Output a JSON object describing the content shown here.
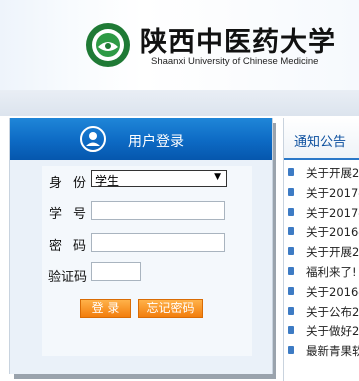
{
  "header": {
    "name_cn": "陕西中医药大学",
    "name_en": "Shaanxi University of Chinese Medicine",
    "logo_icon": "university-emblem-icon"
  },
  "login": {
    "title": "用户登录",
    "user_icon": "user-avatar-icon",
    "identity_label": "身份",
    "identity_value": "学生",
    "student_id_label": "学号",
    "password_label": "密码",
    "captcha_label": "验证码",
    "login_button": "登 录",
    "forgot_button": "忘记密码"
  },
  "notices": {
    "title": "通知公告",
    "items": [
      "关于开展2",
      "关于2017-",
      "关于2017-",
      "关于2016-",
      "关于开展2",
      "福利来了!",
      "关于2016-",
      "关于公布2",
      "关于做好2",
      "最新青果软"
    ]
  },
  "colors": {
    "login_header": "#0d6ac4",
    "button_orange": "#f5901e",
    "notice_title": "#0a4e9e"
  }
}
